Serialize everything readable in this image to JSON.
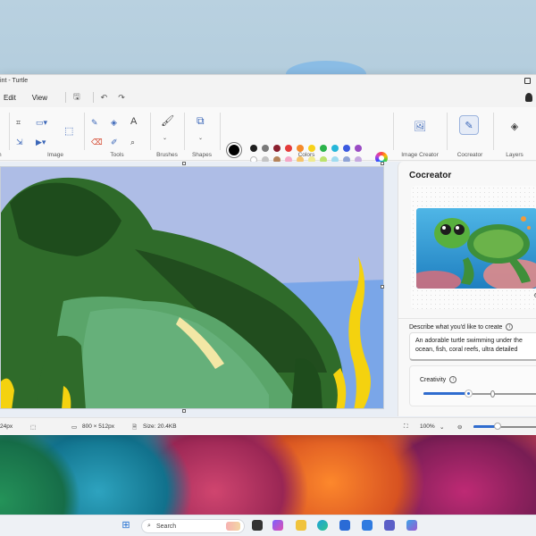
{
  "window": {
    "title": "int - Turtle"
  },
  "menubar": {
    "edit": "Edit",
    "view": "View",
    "save_icon": "save-icon",
    "undo_icon": "undo-icon",
    "redo_icon": "redo-icon"
  },
  "ribbon": {
    "groups": {
      "partial_left": "n",
      "image": "Image",
      "tools": "Tools",
      "brushes": "Brushes",
      "shapes": "Shapes",
      "colors": "Colors",
      "image_creator": "Image Creator",
      "cocreator": "Cocreator",
      "layers": "Layers"
    },
    "palette_row1": [
      "#1f1f1f",
      "#7a7a7a",
      "#8a1f2e",
      "#e43b3b",
      "#f58a2a",
      "#f7d21a",
      "#2bb34a",
      "#26b6d9",
      "#3b5ae0",
      "#9a4bc4"
    ],
    "palette_row2": [
      "#ffffff",
      "#c4c4c4",
      "#b5835a",
      "#f5a7c6",
      "#f7c46a",
      "#f0eb8e",
      "#bde36c",
      "#9fdcf0",
      "#8fa3d6",
      "#c6a9e0"
    ]
  },
  "panel": {
    "title": "Cocreator",
    "preview_count": "6",
    "describe_label": "Describe what you'd like to create",
    "prompt_line1": "An adorable turtle swimming under the",
    "prompt_line2": "ocean, fish, coral reefs, ultra detailed",
    "creativity_label": "Creativity",
    "creativity_level": 0.38
  },
  "status": {
    "cursor_size": "24px",
    "canvas_size": "800 × 512px",
    "file_size": "Size: 20.4KB",
    "zoom": "100%",
    "zoom_level": 0.55
  },
  "taskbar": {
    "search_placeholder": "Search"
  }
}
